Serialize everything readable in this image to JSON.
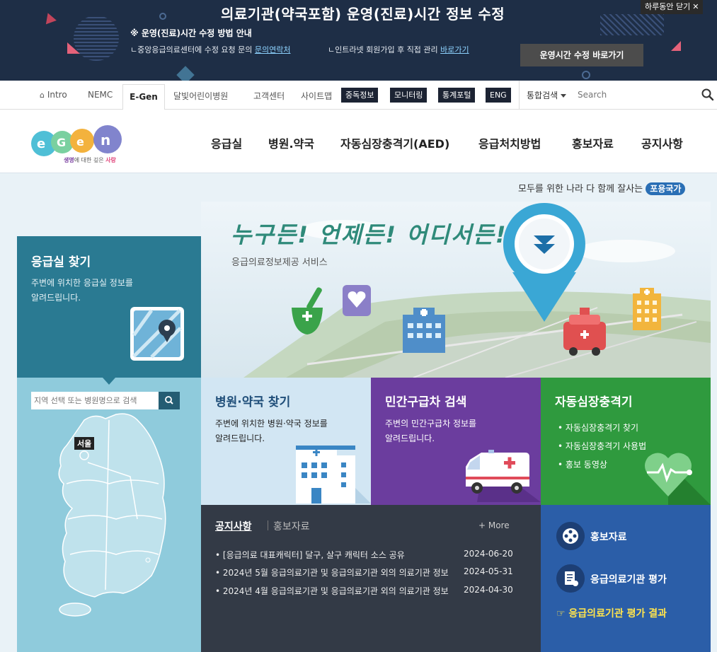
{
  "banner": {
    "title": "의료기관(약국포함) 운영(진료)시간 정보 수정",
    "subhead": "※ 운영(진료)시간 수정 방법 안내",
    "line1_prefix": "ㄴ중앙응급의료센터에 수정 요청 문의 ",
    "line1_link": "문의연락처",
    "line2_prefix": "ㄴ인트라넷 회원가입 후 직접 관리 ",
    "line2_link": "바로가기",
    "close_label": "하루동안 닫기",
    "go_button": "운영시간 수정 바로가기"
  },
  "utilbar": {
    "intro": "Intro",
    "nemc": "NEMC",
    "egen": "E-Gen",
    "links": [
      "달빛어린이병원",
      "고객센터",
      "사이트맵"
    ],
    "dark_buttons": [
      "중독정보",
      "모니터링",
      "통계포털",
      "ENG"
    ],
    "search_scope": "통합검색",
    "search_placeholder": "Search"
  },
  "logo": {
    "tagline_a": "생명",
    "tagline_b": "에 대한 깊은 ",
    "tagline_c": "사랑"
  },
  "nav": [
    "응급실",
    "병원.약국",
    "자동심장충격기(AED)",
    "응급처치방법",
    "홍보자료",
    "공지사항"
  ],
  "hero": {
    "slogan": "모두를 위한 나라 다 함께 잘사는",
    "slogan_badge": "포용국가",
    "headline": "누구든! 언제든! 어디서든!",
    "sub": "응급의료정보제공 서비스"
  },
  "er": {
    "title": "응급실 찾기",
    "desc1": "주변에 위치한 응급실 정보를",
    "desc2": "알려드립니다.",
    "search_placeholder": "지역 선택 또는 병원명으로 검색",
    "map_label": "서울"
  },
  "tiles": {
    "hospital": {
      "title": "병원·약국 찾기",
      "desc1": "주변에 위치한 병원·약국 정보를",
      "desc2": "알려드립니다."
    },
    "ambulance": {
      "title": "민간구급차 검색",
      "desc1": "주변의 민간구급차 정보를",
      "desc2": "알려드립니다."
    },
    "aed": {
      "title": "자동심장충격기",
      "items": [
        "자동심장충격기 찾기",
        "자동심장충격기 사용법",
        "홍보 동영상"
      ]
    }
  },
  "notice": {
    "tab_active": "공지사항",
    "tab_other": "홍보자료",
    "more": "+ More",
    "rows": [
      {
        "title": "• [응급의료 대표캐릭터] 달구, 살구 캐릭터 소스 공유",
        "date": "2024-06-20"
      },
      {
        "title": "• 2024년 5월 응급의료기관 및 응급의료기관 외의 의료기관 정보",
        "date": "2024-05-31"
      },
      {
        "title": "• 2024년 4월 응급의료기관 및 응급의료기관 외의 의료기관 정보",
        "date": "2024-04-30"
      }
    ]
  },
  "promo": {
    "item1": "홍보자료",
    "item2": "응급의료기관 평가",
    "result": "☞ 응급의료기관 평가 결과"
  },
  "colors": {
    "banner_bg": "#1e2e46",
    "er_teal": "#2a7a92",
    "map_blue": "#8fcbdc",
    "tile_hospital": "#d2e6f3",
    "tile_ambulance": "#6b3d9e",
    "tile_aed": "#2f9a3e",
    "notice_bg": "#333a46",
    "promo_blue": "#2b5ea8",
    "result_yellow": "#ffe44d"
  }
}
